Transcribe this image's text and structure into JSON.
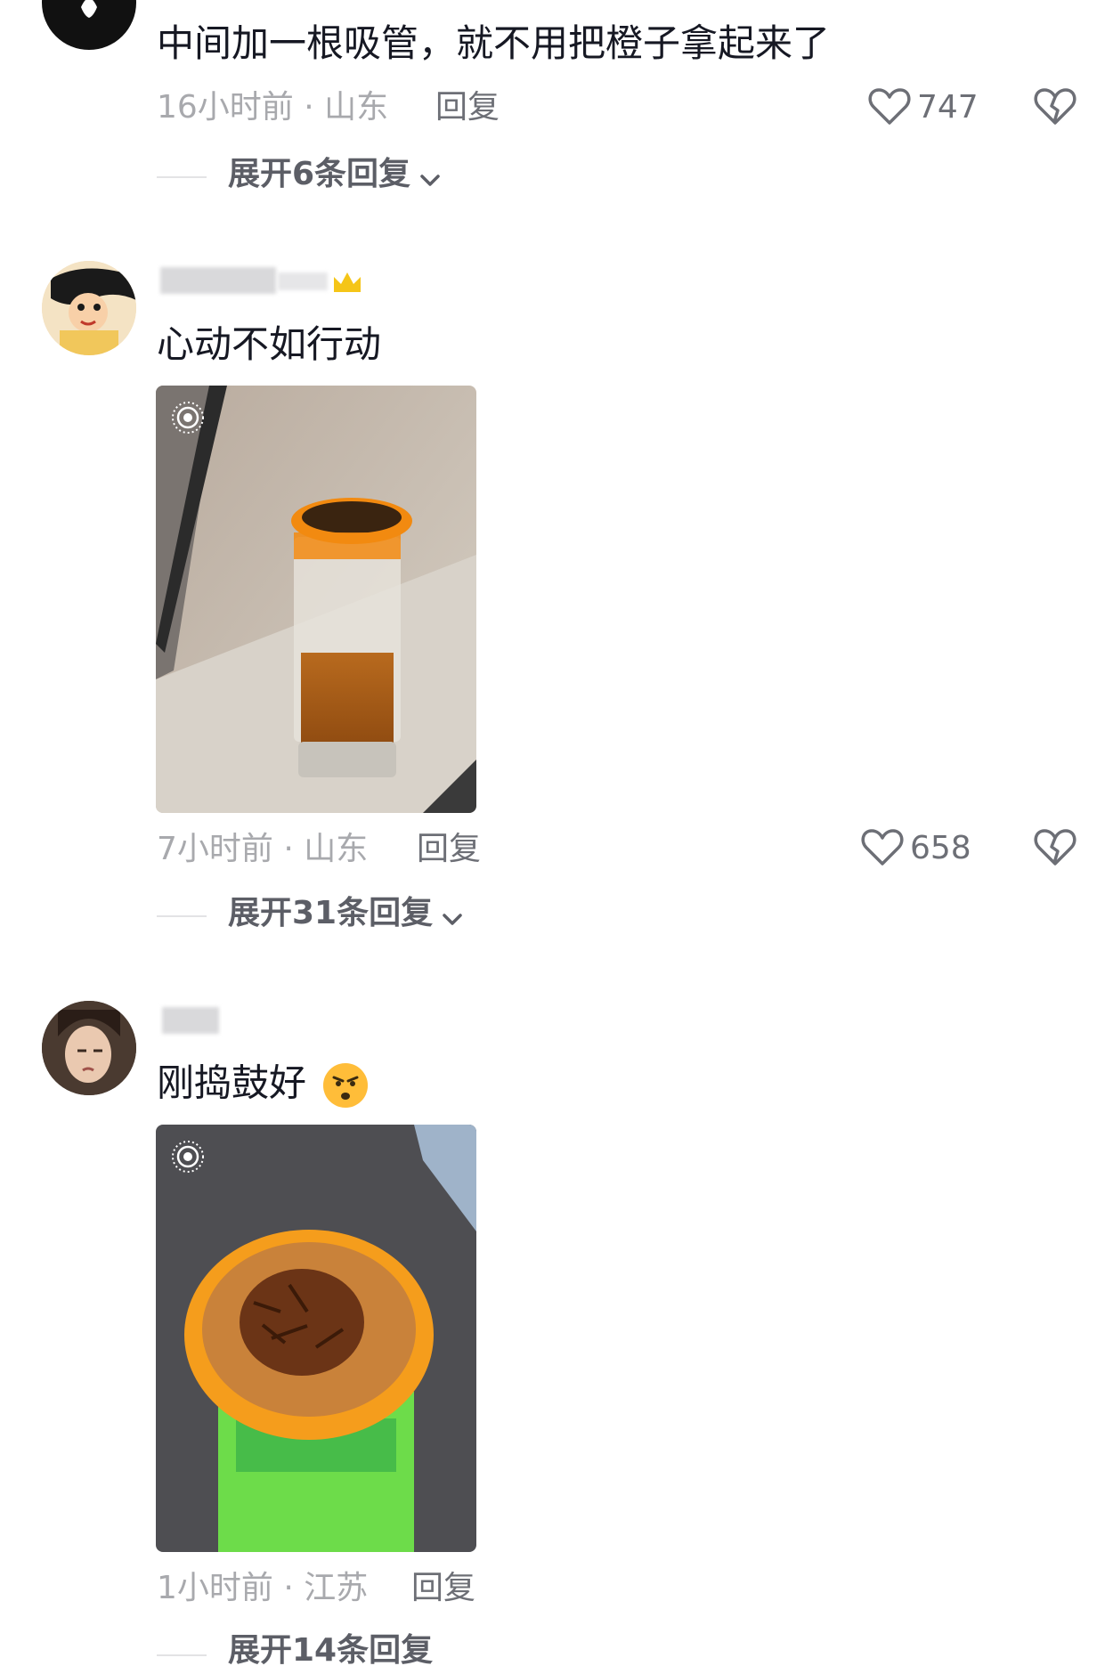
{
  "comments": [
    {
      "text": "中间加一根吸管，就不用把橙子拿起来了",
      "time": "16小时前",
      "sep": "·",
      "location": "山东",
      "reply_label": "回复",
      "likes": "747",
      "expand_label": "展开6条回复"
    },
    {
      "text": "心动不如行动",
      "time": "7小时前",
      "sep": "·",
      "location": "山东",
      "reply_label": "回复",
      "likes": "658",
      "expand_label": "展开31条回复"
    },
    {
      "text": "刚捣鼓好",
      "time": "1小时前",
      "sep": "·",
      "location": "江苏",
      "reply_label": "回复",
      "expand_label": "展开14条回复"
    }
  ],
  "icons": {
    "like": "heart-outline-icon",
    "dislike": "broken-heart-icon",
    "expand": "chevron-down-icon",
    "live_photo": "live-photo-icon",
    "crown": "crown-icon",
    "emoji": "frowning-face-emoji"
  },
  "colors": {
    "primary_text": "#161823",
    "meta_text": "#a8a9ad",
    "action_text": "#6d6f76",
    "crown": "#f5c518"
  }
}
